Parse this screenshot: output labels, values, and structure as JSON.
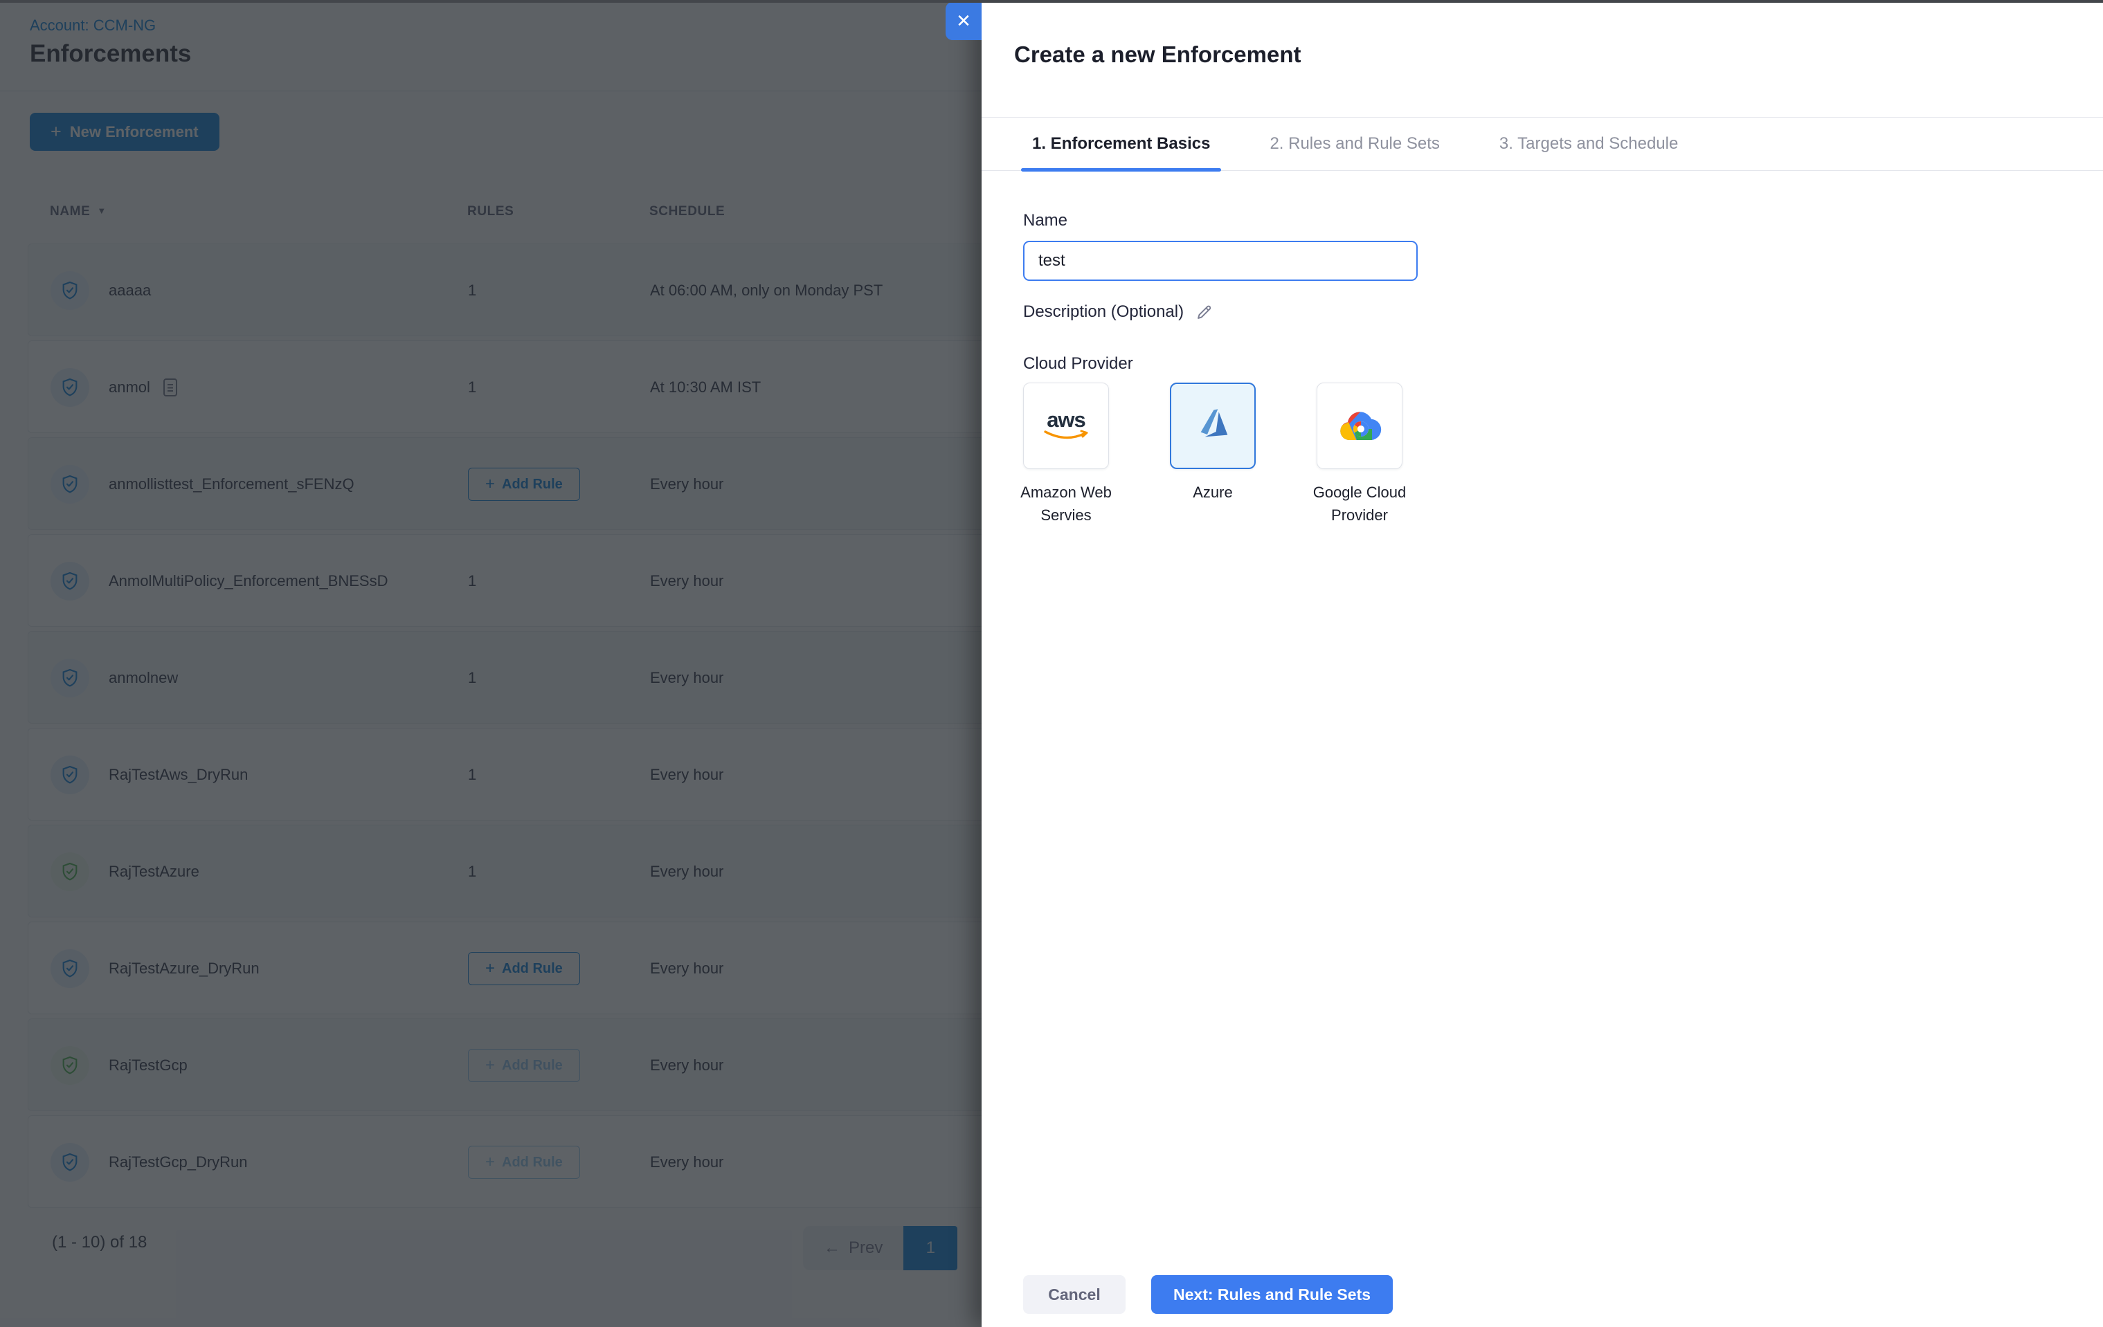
{
  "page": {
    "breadcrumb": "Account: CCM-NG",
    "title": "Enforcements",
    "new_enforcement_label": "New Enforcement",
    "table": {
      "columns": [
        "NAME",
        "RULES",
        "SCHEDULE"
      ],
      "add_rule_label": "Add Rule",
      "rows": [
        {
          "name": "aaaaa",
          "rules": "1",
          "schedule": "At 06:00 AM, only on Monday PST"
        },
        {
          "name": "anmol",
          "rules": "1",
          "schedule": "At 10:30 AM IST"
        },
        {
          "name": "anmollisttest_Enforcement_sFENzQ",
          "rules": "",
          "schedule": "Every hour"
        },
        {
          "name": "AnmolMultiPolicy_Enforcement_BNESsD",
          "rules": "1",
          "schedule": "Every hour"
        },
        {
          "name": "anmolnew",
          "rules": "1",
          "schedule": "Every hour"
        },
        {
          "name": "RajTestAws_DryRun",
          "rules": "1",
          "schedule": "Every hour"
        },
        {
          "name": "RajTestAzure",
          "rules": "1",
          "schedule": "Every hour"
        },
        {
          "name": "RajTestAzure_DryRun",
          "rules": "",
          "schedule": "Every hour"
        },
        {
          "name": "RajTestGcp",
          "rules": "",
          "schedule": "Every hour"
        },
        {
          "name": "RajTestGcp_DryRun",
          "rules": "",
          "schedule": "Every hour"
        }
      ]
    },
    "pagination": {
      "range_text": "(1 - 10) of 18",
      "prev_label": "Prev",
      "page": "1"
    }
  },
  "drawer": {
    "title": "Create a new Enforcement",
    "tabs": [
      {
        "label": "1. Enforcement Basics"
      },
      {
        "label": "2. Rules and Rule Sets"
      },
      {
        "label": "3. Targets and Schedule"
      }
    ],
    "name_label": "Name",
    "name_value": "test",
    "description_label": "Description (Optional)",
    "cloud_provider_label": "Cloud Provider",
    "providers": [
      {
        "label": "Amazon Web Servies"
      },
      {
        "label": "Azure"
      },
      {
        "label": "Google Cloud Provider"
      }
    ],
    "aws_logo_text": "aws",
    "cancel_label": "Cancel",
    "next_label": "Next: Rules and Rule Sets"
  },
  "icons": {
    "plus": "+",
    "sort_caret": "▼",
    "prev_arrow": "←",
    "close": "✕"
  },
  "colors": {
    "accent_blue": "#0278d5",
    "drawer_blue": "#3d7cf0",
    "shield_green": "#42ab45"
  }
}
